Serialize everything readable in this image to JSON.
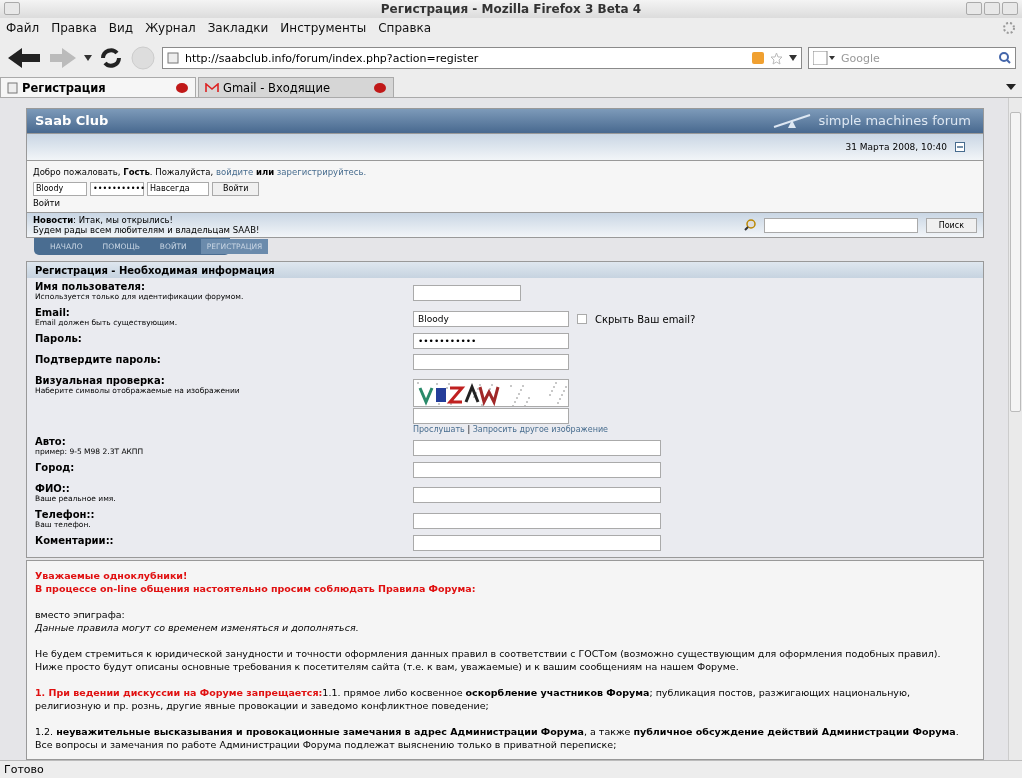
{
  "window": {
    "title": "Регистрация - Mozilla Firefox 3 Beta 4"
  },
  "menu": [
    "Файл",
    "Правка",
    "Вид",
    "Журнал",
    "Закладки",
    "Инструменты",
    "Справка"
  ],
  "address": {
    "value": "http://saabclub.info/forum/index.php?action=register"
  },
  "search_engine": {
    "placeholder": "Google"
  },
  "tabs": [
    {
      "label": "Регистрация",
      "selected": true,
      "kind": "page"
    },
    {
      "label": "Gmail - Входящие",
      "selected": false,
      "kind": "gmail"
    }
  ],
  "forum": {
    "title": "Saab Club",
    "logo_text": "simple machines forum",
    "date": "31 Марта 2008, 10:40",
    "welcome": {
      "text": "Добро пожаловать, **Гость**. Пожалуйста,",
      "login_link": "войдите",
      "or": "или",
      "register_link": "зарегистрируйтесь."
    },
    "login": {
      "username": "Bloody",
      "password": "•••••••••••",
      "duration": "Навсегда",
      "button": "Войти",
      "caption": "Войти"
    },
    "news": {
      "text": "**Новости**: Итак, мы открылись!",
      "line2": "Будем рады всем любителям и владельцам SAAB!"
    },
    "search_button": "Поиск",
    "nav": [
      {
        "label": "НАЧАЛО",
        "selected": false
      },
      {
        "label": "ПОМОЩЬ",
        "selected": false
      },
      {
        "label": "ВОЙТИ",
        "selected": false
      },
      {
        "label": "РЕГИСТРАЦИЯ",
        "selected": true
      }
    ]
  },
  "registration": {
    "title": "Регистрация - Необходимая информация",
    "fields": [
      {
        "label": "Имя пользователя:",
        "hint": "Используется только для идентификации форумом.",
        "kind": "text"
      },
      {
        "label": "Email:",
        "hint": "Email должен быть существующим.",
        "kind": "text",
        "value": "Bloody",
        "checkbox": {
          "label": "Скрыть Ваш email?",
          "checked": false
        }
      },
      {
        "label": "Пароль:",
        "kind": "password",
        "value": "•••••••••••"
      },
      {
        "label": "Подтвердите пароль:",
        "kind": "password"
      },
      {
        "label": "Визуальная проверка:",
        "hint": "Наберите символы отображаемые на изображении",
        "kind": "captcha",
        "links": [
          "Прослушать",
          "Запросить другое изображение"
        ],
        "separator": "|"
      },
      {
        "label": "Авто:",
        "hint": "пример: 9-5 M98 2.3T АКПП",
        "kind": "text"
      },
      {
        "label": "Город:",
        "kind": "text"
      },
      {
        "label": "ФИО::",
        "hint": "Ваше реальное имя.",
        "kind": "text"
      },
      {
        "label": "Телефон::",
        "hint": "Ваш телефон.",
        "kind": "text"
      },
      {
        "label": "Коментарии::",
        "kind": "text"
      }
    ]
  },
  "rules": [
    {
      "kind": "heading",
      "text": "Уважаемые одноклубники!"
    },
    {
      "kind": "heading",
      "text": "В процессе on-line общения настоятельно просим соблюдать Правила Форума:"
    },
    {
      "kind": "gap"
    },
    {
      "kind": "plain",
      "text": "вместо эпиграфа:"
    },
    {
      "kind": "italic",
      "text": "Данные правила могут со временем изменяться и дополняться."
    },
    {
      "kind": "gap"
    },
    {
      "kind": "plain",
      "text": "Не будем стремиться к юридической занудности и точности оформления данных правил в соответствии с ГОСТом (возможно существующим для оформления подобных правил)."
    },
    {
      "kind": "plain",
      "text": "Ниже просто будут описаны основные требования к посетителям сайта (т.е. к вам, уважаемые) и к вашим сообщениям на нашем Форуме."
    },
    {
      "kind": "gap"
    },
    {
      "kind": "item",
      "heading": "1. При ведении дискуссии на Форуме запрещается:",
      "text": "1.1. прямое либо косвенное **оскорбление участников Форума**; публикация постов, разжигающих национальную, религиозную и пр. рознь, другие явные провокации и заведомо конфликтное поведение;"
    },
    {
      "kind": "gap"
    },
    {
      "kind": "plain",
      "text": "1.2. **неуважительные высказывания и провокационные замечания в адрес Администрации Форума**, а также **публичное обсуждение действий Администрации Форума**. Все вопросы и замечания по работе Администрации Форума подлежат выяснению только в приватной переписке;"
    }
  ],
  "status_bar": "Готово"
}
